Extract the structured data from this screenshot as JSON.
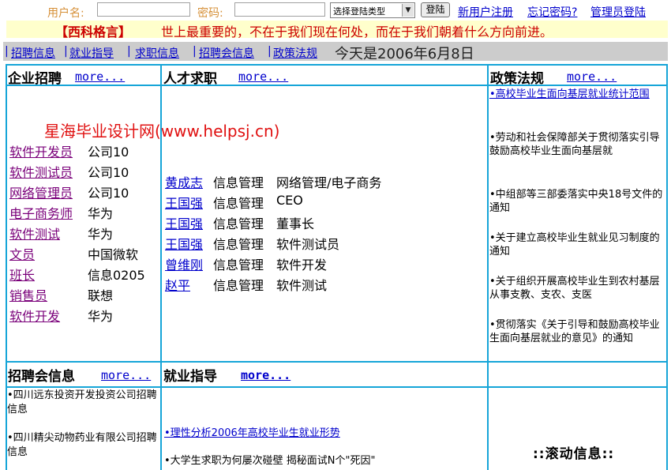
{
  "login": {
    "username_label": "用户名:",
    "password_label": "密码:",
    "username_value": "",
    "password_value": "",
    "type_select": "选择登陆类型",
    "login_button": "登陆",
    "register": "新用户注册",
    "forgot": "忘记密码?",
    "admin": "管理员登陆"
  },
  "motto": {
    "title": "【西科格言】",
    "text": "世上最重要的，不在于我们现在何处，而在于我们朝着什么方向前进。"
  },
  "nav": {
    "items": [
      "招聘信息",
      "就业指导",
      "求职信息",
      "招聘会信息",
      "政策法规"
    ],
    "date": "今天是2006年6月8日"
  },
  "sections": {
    "jobs_title": "企业招聘",
    "talent_title": "人才求职",
    "policy_title": "政策法规",
    "fair_title": "招聘会信息",
    "guide_title": "就业指导",
    "more": "more..."
  },
  "watermark": "星海毕业设计网(www.helpsj.cn)",
  "jobs": [
    {
      "title": "软件开发员",
      "company": "公司10"
    },
    {
      "title": "软件测试员",
      "company": "公司10"
    },
    {
      "title": "网络管理员",
      "company": "公司10"
    },
    {
      "title": "电子商务师",
      "company": "华为"
    },
    {
      "title": "软件测试",
      "company": "华为"
    },
    {
      "title": "文员",
      "company": "中国微软"
    },
    {
      "title": "班长",
      "company": "信息0205"
    },
    {
      "title": "销售员",
      "company": "联想"
    },
    {
      "title": "软件开发",
      "company": "华为"
    }
  ],
  "talents": [
    {
      "name": "黄成志",
      "major": "信息管理",
      "position": "网络管理/电子商务"
    },
    {
      "name": "王国强",
      "major": "信息管理",
      "position": "CEO"
    },
    {
      "name": "王国强",
      "major": "信息管理",
      "position": "董事长"
    },
    {
      "name": "王国强",
      "major": "信息管理",
      "position": "软件测试员"
    },
    {
      "name": "曾维刚",
      "major": "信息管理",
      "position": "软件开发"
    },
    {
      "name": "赵平",
      "major": "信息管理",
      "position": "软件测试"
    }
  ],
  "policies": [
    "•高校毕业生面向基层就业统计范围",
    "•劳动和社会保障部关于贯彻落实引导鼓励高校毕业生面向基层就",
    "•中组部等三部委落实中央18号文件的通知",
    "•关于建立高校毕业生就业见习制度的通知",
    "•关于组织开展高校毕业生到农村基层从事支教、支农、支医",
    "•贯彻落实《关于引导和鼓励高校毕业生面向基层就业的意见》的通知"
  ],
  "fairs": [
    "•四川远东投资开发投资公司招聘信息",
    "•四川精尖动物药业有限公司招聘信息"
  ],
  "guides": [
    "•理性分析2006年高校毕业生就业形势",
    "•大学生求职为何屡次碰壁 揭秘面试N个\"死因\""
  ],
  "scroll_title": "::滚动信息::"
}
